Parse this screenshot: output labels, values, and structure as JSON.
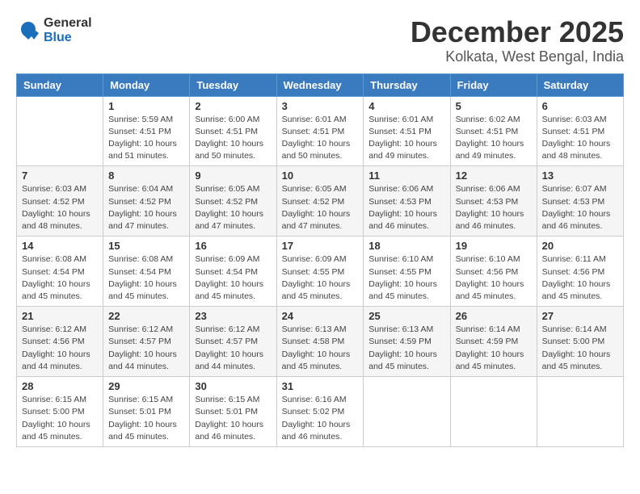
{
  "header": {
    "logo_general": "General",
    "logo_blue": "Blue",
    "title": "December 2025",
    "subtitle": "Kolkata, West Bengal, India"
  },
  "weekdays": [
    "Sunday",
    "Monday",
    "Tuesday",
    "Wednesday",
    "Thursday",
    "Friday",
    "Saturday"
  ],
  "weeks": [
    [
      {
        "day": "",
        "sunrise": "",
        "sunset": "",
        "daylight": ""
      },
      {
        "day": "1",
        "sunrise": "Sunrise: 5:59 AM",
        "sunset": "Sunset: 4:51 PM",
        "daylight": "Daylight: 10 hours and 51 minutes."
      },
      {
        "day": "2",
        "sunrise": "Sunrise: 6:00 AM",
        "sunset": "Sunset: 4:51 PM",
        "daylight": "Daylight: 10 hours and 50 minutes."
      },
      {
        "day": "3",
        "sunrise": "Sunrise: 6:01 AM",
        "sunset": "Sunset: 4:51 PM",
        "daylight": "Daylight: 10 hours and 50 minutes."
      },
      {
        "day": "4",
        "sunrise": "Sunrise: 6:01 AM",
        "sunset": "Sunset: 4:51 PM",
        "daylight": "Daylight: 10 hours and 49 minutes."
      },
      {
        "day": "5",
        "sunrise": "Sunrise: 6:02 AM",
        "sunset": "Sunset: 4:51 PM",
        "daylight": "Daylight: 10 hours and 49 minutes."
      },
      {
        "day": "6",
        "sunrise": "Sunrise: 6:03 AM",
        "sunset": "Sunset: 4:51 PM",
        "daylight": "Daylight: 10 hours and 48 minutes."
      }
    ],
    [
      {
        "day": "7",
        "sunrise": "Sunrise: 6:03 AM",
        "sunset": "Sunset: 4:52 PM",
        "daylight": "Daylight: 10 hours and 48 minutes."
      },
      {
        "day": "8",
        "sunrise": "Sunrise: 6:04 AM",
        "sunset": "Sunset: 4:52 PM",
        "daylight": "Daylight: 10 hours and 47 minutes."
      },
      {
        "day": "9",
        "sunrise": "Sunrise: 6:05 AM",
        "sunset": "Sunset: 4:52 PM",
        "daylight": "Daylight: 10 hours and 47 minutes."
      },
      {
        "day": "10",
        "sunrise": "Sunrise: 6:05 AM",
        "sunset": "Sunset: 4:52 PM",
        "daylight": "Daylight: 10 hours and 47 minutes."
      },
      {
        "day": "11",
        "sunrise": "Sunrise: 6:06 AM",
        "sunset": "Sunset: 4:53 PM",
        "daylight": "Daylight: 10 hours and 46 minutes."
      },
      {
        "day": "12",
        "sunrise": "Sunrise: 6:06 AM",
        "sunset": "Sunset: 4:53 PM",
        "daylight": "Daylight: 10 hours and 46 minutes."
      },
      {
        "day": "13",
        "sunrise": "Sunrise: 6:07 AM",
        "sunset": "Sunset: 4:53 PM",
        "daylight": "Daylight: 10 hours and 46 minutes."
      }
    ],
    [
      {
        "day": "14",
        "sunrise": "Sunrise: 6:08 AM",
        "sunset": "Sunset: 4:54 PM",
        "daylight": "Daylight: 10 hours and 45 minutes."
      },
      {
        "day": "15",
        "sunrise": "Sunrise: 6:08 AM",
        "sunset": "Sunset: 4:54 PM",
        "daylight": "Daylight: 10 hours and 45 minutes."
      },
      {
        "day": "16",
        "sunrise": "Sunrise: 6:09 AM",
        "sunset": "Sunset: 4:54 PM",
        "daylight": "Daylight: 10 hours and 45 minutes."
      },
      {
        "day": "17",
        "sunrise": "Sunrise: 6:09 AM",
        "sunset": "Sunset: 4:55 PM",
        "daylight": "Daylight: 10 hours and 45 minutes."
      },
      {
        "day": "18",
        "sunrise": "Sunrise: 6:10 AM",
        "sunset": "Sunset: 4:55 PM",
        "daylight": "Daylight: 10 hours and 45 minutes."
      },
      {
        "day": "19",
        "sunrise": "Sunrise: 6:10 AM",
        "sunset": "Sunset: 4:56 PM",
        "daylight": "Daylight: 10 hours and 45 minutes."
      },
      {
        "day": "20",
        "sunrise": "Sunrise: 6:11 AM",
        "sunset": "Sunset: 4:56 PM",
        "daylight": "Daylight: 10 hours and 45 minutes."
      }
    ],
    [
      {
        "day": "21",
        "sunrise": "Sunrise: 6:12 AM",
        "sunset": "Sunset: 4:56 PM",
        "daylight": "Daylight: 10 hours and 44 minutes."
      },
      {
        "day": "22",
        "sunrise": "Sunrise: 6:12 AM",
        "sunset": "Sunset: 4:57 PM",
        "daylight": "Daylight: 10 hours and 44 minutes."
      },
      {
        "day": "23",
        "sunrise": "Sunrise: 6:12 AM",
        "sunset": "Sunset: 4:57 PM",
        "daylight": "Daylight: 10 hours and 44 minutes."
      },
      {
        "day": "24",
        "sunrise": "Sunrise: 6:13 AM",
        "sunset": "Sunset: 4:58 PM",
        "daylight": "Daylight: 10 hours and 45 minutes."
      },
      {
        "day": "25",
        "sunrise": "Sunrise: 6:13 AM",
        "sunset": "Sunset: 4:59 PM",
        "daylight": "Daylight: 10 hours and 45 minutes."
      },
      {
        "day": "26",
        "sunrise": "Sunrise: 6:14 AM",
        "sunset": "Sunset: 4:59 PM",
        "daylight": "Daylight: 10 hours and 45 minutes."
      },
      {
        "day": "27",
        "sunrise": "Sunrise: 6:14 AM",
        "sunset": "Sunset: 5:00 PM",
        "daylight": "Daylight: 10 hours and 45 minutes."
      }
    ],
    [
      {
        "day": "28",
        "sunrise": "Sunrise: 6:15 AM",
        "sunset": "Sunset: 5:00 PM",
        "daylight": "Daylight: 10 hours and 45 minutes."
      },
      {
        "day": "29",
        "sunrise": "Sunrise: 6:15 AM",
        "sunset": "Sunset: 5:01 PM",
        "daylight": "Daylight: 10 hours and 45 minutes."
      },
      {
        "day": "30",
        "sunrise": "Sunrise: 6:15 AM",
        "sunset": "Sunset: 5:01 PM",
        "daylight": "Daylight: 10 hours and 46 minutes."
      },
      {
        "day": "31",
        "sunrise": "Sunrise: 6:16 AM",
        "sunset": "Sunset: 5:02 PM",
        "daylight": "Daylight: 10 hours and 46 minutes."
      },
      {
        "day": "",
        "sunrise": "",
        "sunset": "",
        "daylight": ""
      },
      {
        "day": "",
        "sunrise": "",
        "sunset": "",
        "daylight": ""
      },
      {
        "day": "",
        "sunrise": "",
        "sunset": "",
        "daylight": ""
      }
    ]
  ]
}
